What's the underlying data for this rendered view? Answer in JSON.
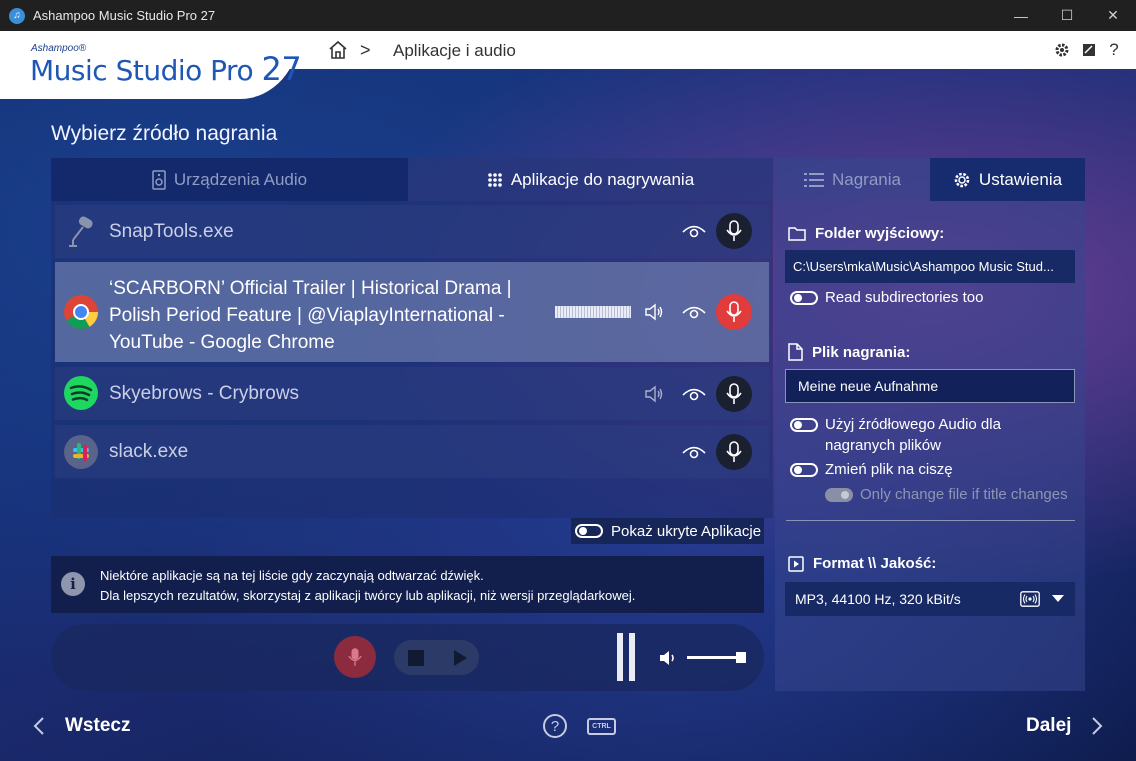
{
  "window": {
    "title": "Ashampoo Music Studio Pro 27",
    "app_icon": "music-note-icon"
  },
  "logo": {
    "brand": "Ashampoo®",
    "product": "Music Studio Pro",
    "version": "27"
  },
  "breadcrumb": {
    "home_icon": "home-icon",
    "separator": ">",
    "current": "Aplikacje i audio"
  },
  "header_icons": [
    "gear-icon",
    "notes-icon",
    "help-icon"
  ],
  "page": {
    "title": "Wybierz źródło nagrania"
  },
  "source_tabs": [
    {
      "label": "Urządzenia Audio",
      "icon": "speaker-device-icon",
      "active": false
    },
    {
      "label": "Aplikacje do nagrywania",
      "icon": "app-grid-icon",
      "active": true
    }
  ],
  "apps": [
    {
      "label": "SnapTools.exe",
      "icon": "microphone-app-icon",
      "selected": false,
      "recording": false,
      "has_speaker": false,
      "has_level": false
    },
    {
      "label_lines": [
        "‘SCARBORN’ Official Trailer | Historical Drama |",
        "Polish Period Feature | @ViaplayInternational -",
        "YouTube - Google Chrome"
      ],
      "icon": "chrome-icon",
      "selected": true,
      "recording": true,
      "has_speaker": true,
      "has_level": true
    },
    {
      "label": "Skyebrows - Crybrows",
      "icon": "spotify-icon",
      "selected": false,
      "recording": false,
      "has_speaker": true,
      "has_level": false
    },
    {
      "label": "slack.exe",
      "icon": "slack-icon",
      "selected": false,
      "recording": false,
      "has_speaker": false,
      "has_level": false
    }
  ],
  "show_hidden": {
    "label": "Pokaż ukryte Aplikacje",
    "enabled": false
  },
  "info": {
    "line1": "Niektóre aplikacje są na tej liście gdy zaczynają odtwarzać dźwięk.",
    "line2": "Dla lepszych rezultatów, skorzystaj z aplikacji twórcy lub aplikacji, niż wersji przeglądarkowej."
  },
  "volume": {
    "level": 1.0
  },
  "right_tabs": [
    {
      "label": "Nagrania",
      "icon": "list-icon",
      "active": false
    },
    {
      "label": "Ustawienia",
      "icon": "gear-icon",
      "active": true
    }
  ],
  "settings": {
    "output_folder": {
      "label": "Folder wyjściowy:",
      "value": "C:\\Users\\mka\\Music\\Ashampoo Music Stud..."
    },
    "read_subdirs": "Read subdirectories too",
    "recording_file": {
      "label": "Plik nagrania:",
      "value": "Meine neue Aufnahme"
    },
    "use_source_audio": [
      "Użyj źródłowego Audio dla",
      "nagranych plików"
    ],
    "change_on_silence": "Zmień plik na ciszę",
    "only_title_change": "Only change file if title changes",
    "format": {
      "label": "Format \\\\ Jakość:",
      "value": "MP3, 44100 Hz, 320 kBit/s"
    }
  },
  "footer": {
    "back": "Wstecz",
    "next": "Dalej",
    "ctrl_label": "CTRL"
  },
  "colors": {
    "accent_red": "#e23b3b",
    "logo_blue": "#1f57b7"
  }
}
